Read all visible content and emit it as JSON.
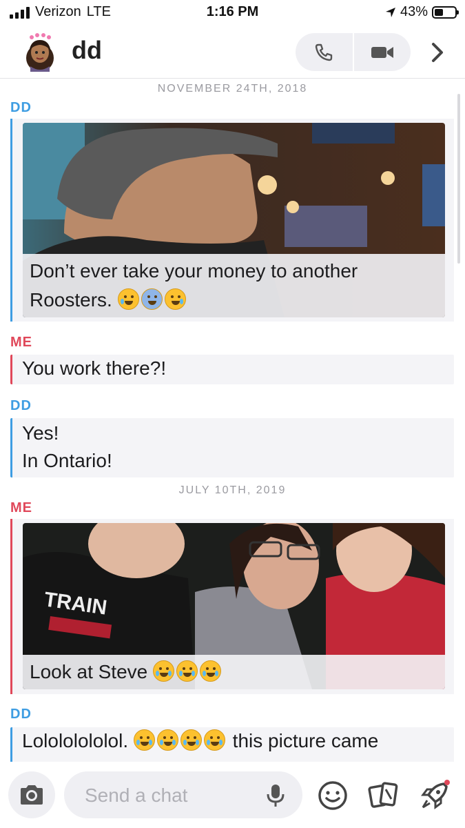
{
  "status_bar": {
    "carrier": "Verizon",
    "network": "LTE",
    "time": "1:16 PM",
    "battery": "43%",
    "battery_level": 0.43
  },
  "header": {
    "contact_name": "dd",
    "avatar_icon": "bitmoji-avatar",
    "buttons": [
      "phone-icon",
      "video-icon",
      "chevron-right-icon"
    ]
  },
  "chat": {
    "date_1": "NOVEMBER 24TH, 2018",
    "date_2": "JULY 10TH, 2019",
    "messages": [
      {
        "sender": "DD",
        "type": "photo",
        "caption": "Don’t ever take your money to another Roosters.",
        "emojis": [
          "weary-face",
          "screaming-face",
          "crying-face"
        ]
      },
      {
        "sender": "ME",
        "type": "text",
        "text": "You work there?!"
      },
      {
        "sender": "DD",
        "type": "text",
        "lines": [
          "Yes!",
          "In Ontario!"
        ]
      },
      {
        "sender": "ME",
        "type": "photo",
        "caption": "Look at Steve",
        "emojis": [
          "loudly-crying-face",
          "loudly-crying-face",
          "loudly-crying-face"
        ]
      },
      {
        "sender": "DD",
        "type": "text",
        "text_before": "Lolololololol.",
        "text_after": "this picture came",
        "emojis": [
          "tears-of-joy-face",
          "tears-of-joy-face",
          "tears-of-joy-face",
          "tears-of-joy-face"
        ]
      }
    ]
  },
  "composer": {
    "placeholder": "Send a chat",
    "icons": [
      "camera-icon",
      "microphone-icon",
      "smiley-icon",
      "cards-icon",
      "rocket-icon"
    ]
  },
  "colors": {
    "dd": "#3e9de2",
    "me": "#e0485a",
    "bubble": "#f4f4f7"
  }
}
